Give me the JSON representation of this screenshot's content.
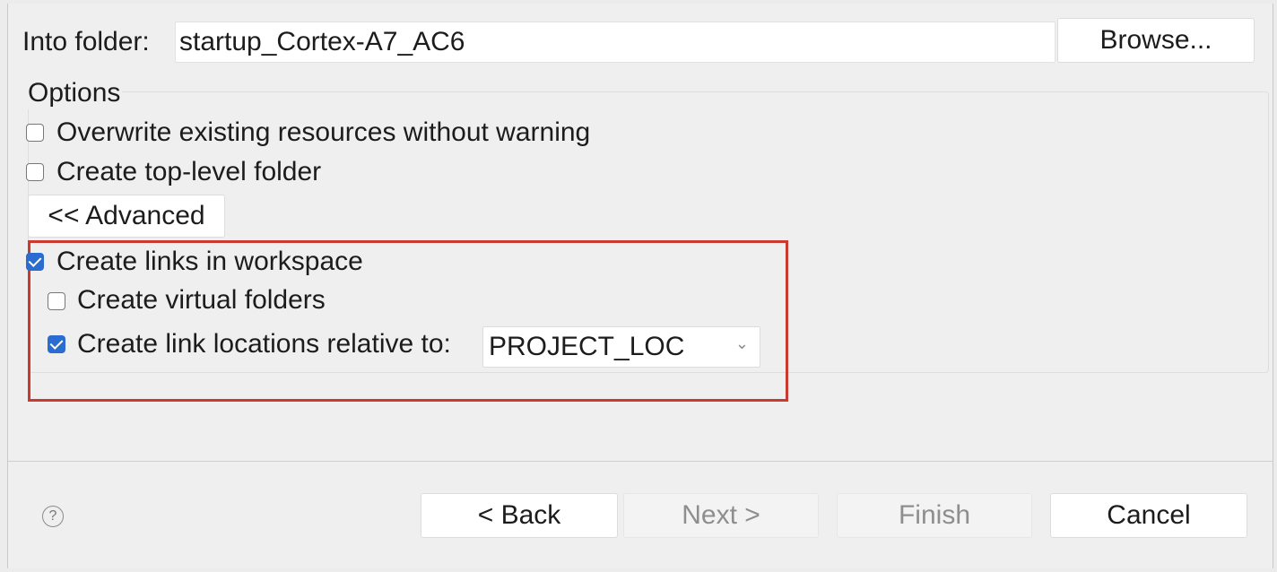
{
  "folder": {
    "label": "Into folder:",
    "value": "startup_Cortex-A7_AC6",
    "browse_label": "Browse..."
  },
  "options": {
    "group_label": "Options",
    "overwrite": {
      "label": "Overwrite existing resources without warning",
      "checked": false
    },
    "top_level": {
      "label": "Create top-level folder",
      "checked": false
    },
    "advanced_label": "<< Advanced",
    "create_links": {
      "label": "Create links in workspace",
      "checked": true
    },
    "virtual_folders": {
      "label": "Create virtual folders",
      "checked": false
    },
    "relative": {
      "label": "Create link locations relative to:",
      "checked": true
    },
    "relative_select": {
      "value": "PROJECT_LOC",
      "chevron_icon": "chevron-down"
    }
  },
  "buttons": {
    "help_icon": "?",
    "back": "< Back",
    "next": "Next >",
    "finish": "Finish",
    "cancel": "Cancel"
  },
  "colors": {
    "highlight_border": "#c93a30",
    "checkbox_checked": "#2b6cd0"
  }
}
